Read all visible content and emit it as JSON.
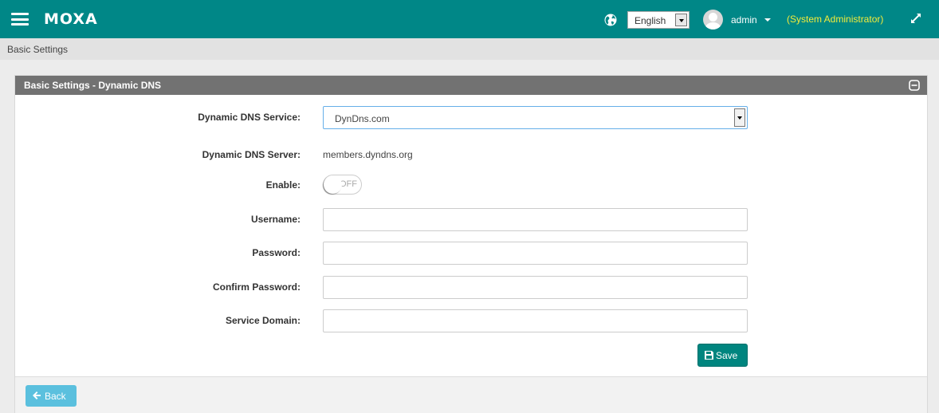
{
  "header": {
    "brand": "MOXA",
    "language": "English",
    "user": "admin",
    "role": "(System Administrator)",
    "colors": {
      "primary": "#008787",
      "role_text": "#f3ec3a"
    }
  },
  "breadcrumb": "Basic Settings",
  "panel": {
    "title": "Basic Settings - Dynamic DNS",
    "fields": {
      "service_label": "Dynamic DNS Service:",
      "service_value": "DynDns.com",
      "server_label": "Dynamic DNS Server:",
      "server_value": "members.dyndns.org",
      "enable_label": "Enable:",
      "enable_state": "OFF",
      "username_label": "Username:",
      "username_value": "",
      "password_label": "Password:",
      "password_value": "",
      "confirm_label": "Confirm Password:",
      "confirm_value": "",
      "domain_label": "Service Domain:",
      "domain_value": ""
    },
    "save_label": "Save",
    "back_label": "Back"
  },
  "icons": {
    "menu": "hamburger-icon",
    "language": "globe-icon",
    "user": "avatar-icon",
    "fullscreen": "expand-icon",
    "collapse": "collapse-icon",
    "save": "floppy-disk-icon",
    "back": "arrow-left-icon"
  }
}
